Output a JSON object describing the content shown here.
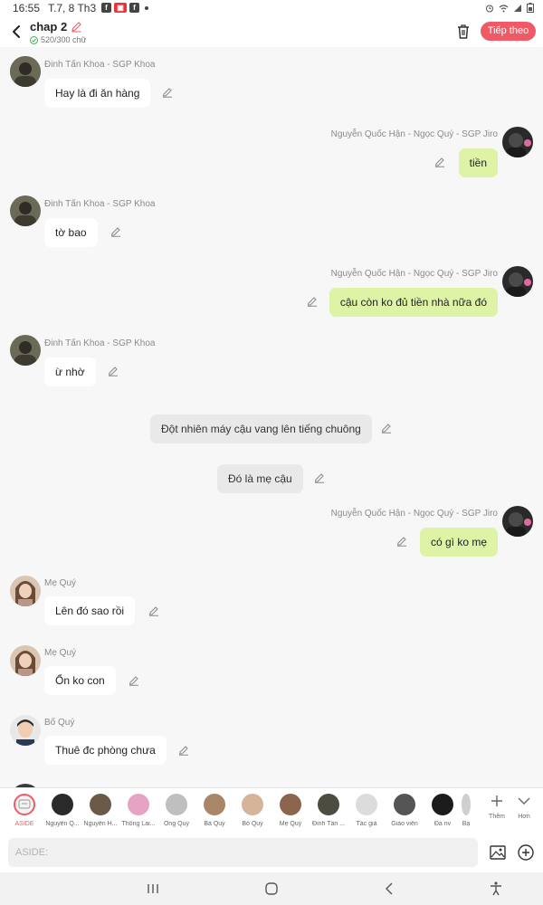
{
  "status": {
    "time": "16:55",
    "date": "T.7, 8 Th3"
  },
  "header": {
    "title": "chap 2",
    "word_count": "520/300 chữ",
    "next_label": "Tiếp theo"
  },
  "messages": [
    {
      "speaker": "Đinh Tấn Khoa - SGP Khoa",
      "text": "Hay là đi ăn hàng",
      "side": "left"
    },
    {
      "speaker": "Nguyễn Quốc Hận - Ngọc Quý - SGP Jiro",
      "text": "tiền",
      "side": "right"
    },
    {
      "speaker": "Đinh Tấn Khoa - SGP Khoa",
      "text": "tờ bao",
      "side": "left"
    },
    {
      "speaker": "Nguyễn Quốc Hận - Ngọc Quý - SGP Jiro",
      "text": "cậu còn ko đủ tiền nhà nữa đó",
      "side": "right"
    },
    {
      "speaker": "Đinh Tấn Khoa - SGP Khoa",
      "text": "ừ nhờ",
      "side": "left"
    },
    {
      "speaker": "",
      "text": "Đột nhiên máy cậu vang lên tiếng chuông",
      "side": "center"
    },
    {
      "speaker": "",
      "text": "Đó là mẹ cậu",
      "side": "center"
    },
    {
      "speaker": "Nguyễn Quốc Hận - Ngọc Quý - SGP Jiro",
      "text": "có gì ko mẹ",
      "side": "right"
    },
    {
      "speaker": "Mẹ Quý",
      "text": "Lên đó sao rồi",
      "side": "left"
    },
    {
      "speaker": "Mẹ Quý",
      "text": "Ổn ko con",
      "side": "left"
    },
    {
      "speaker": "Bố Quý",
      "text": "Thuê đc phòng chưa",
      "side": "left"
    }
  ],
  "characters": [
    {
      "label": "ASIDE"
    },
    {
      "label": "Nguyễn Q..."
    },
    {
      "label": "Nguyễn H..."
    },
    {
      "label": "Thông Lai..."
    },
    {
      "label": "Ông Quý"
    },
    {
      "label": "Bà Quý"
    },
    {
      "label": "Bố Quý"
    },
    {
      "label": "Mẹ Quý"
    },
    {
      "label": "Đinh Tấn ..."
    },
    {
      "label": "Tác giả"
    },
    {
      "label": "Giáo viên"
    },
    {
      "label": "Đa nv"
    },
    {
      "label": "Bạ"
    }
  ],
  "toolbar": {
    "more_label": "Thêm",
    "collapse_label": "Hơn"
  },
  "input": {
    "placeholder": "ASIDE:"
  },
  "colors": {
    "accent": "#f05a67",
    "right_bubble": "#dff3a6",
    "left_bubble": "#ffffff",
    "narration_bubble": "#e9e9e9"
  }
}
